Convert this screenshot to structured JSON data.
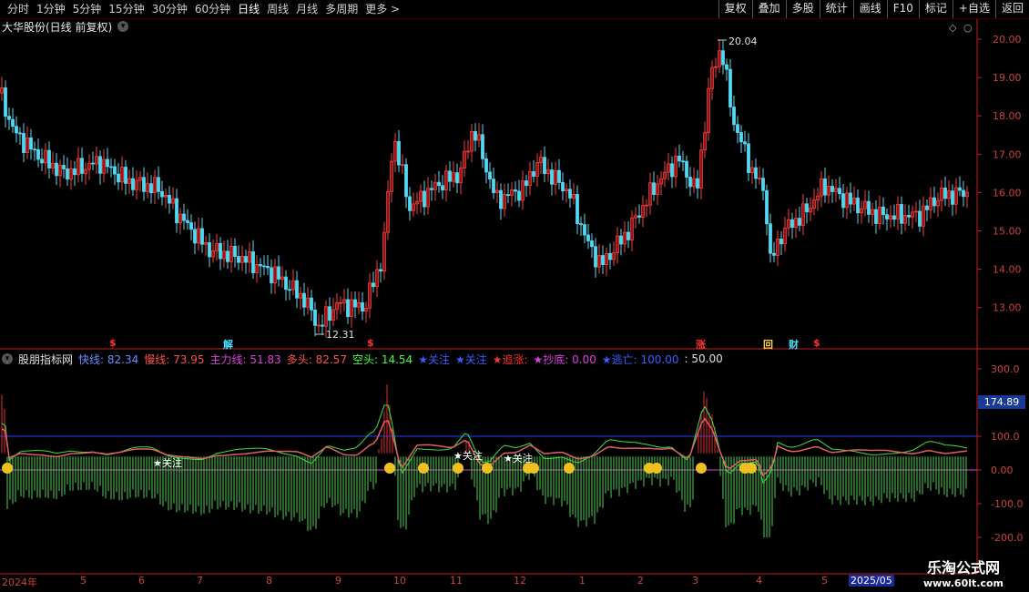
{
  "toolbar": {
    "tabs": [
      {
        "label": "分时",
        "active": false
      },
      {
        "label": "1分钟",
        "active": false
      },
      {
        "label": "5分钟",
        "active": false
      },
      {
        "label": "15分钟",
        "active": false
      },
      {
        "label": "30分钟",
        "active": false
      },
      {
        "label": "60分钟",
        "active": false
      },
      {
        "label": "日线",
        "active": true
      },
      {
        "label": "周线",
        "active": false
      },
      {
        "label": "月线",
        "active": false
      },
      {
        "label": "多周期",
        "active": false
      },
      {
        "label": "更多 >",
        "active": false
      }
    ],
    "buttons": [
      "复权",
      "叠加",
      "多股",
      "统计",
      "画线",
      "F10",
      "标记",
      "+自选",
      "返回"
    ]
  },
  "main_chart": {
    "title": "大华股份(日线 前复权)",
    "high_label": "20.04",
    "low_label": "12.31",
    "price_ticks": [
      "20.00",
      "19.00",
      "18.00",
      "17.00",
      "16.00",
      "15.00",
      "14.00",
      "13.00"
    ],
    "event_markers": [
      {
        "text": "$",
        "color": "#ff3333"
      },
      {
        "text": "解",
        "color": "#40e0ff"
      },
      {
        "text": "$",
        "color": "#ff3333"
      },
      {
        "text": "涨",
        "color": "#ff3333"
      },
      {
        "text": "回",
        "color": "#ffd040"
      },
      {
        "text": "财",
        "color": "#40e0ff"
      },
      {
        "text": "$",
        "color": "#ff3333"
      }
    ]
  },
  "indicator": {
    "name": "股朋指标网",
    "fast_label": "快线:",
    "fast_value": "82.34",
    "slow_label": "慢线:",
    "slow_value": "73.95",
    "main_label": "主力线:",
    "main_value": "51.83",
    "long_label": "多头:",
    "long_value": "82.57",
    "short_label": "空头:",
    "short_value": "14.54",
    "focus1_label": "★关注",
    "focus2_label": "★关注",
    "chase_label": "★追涨:",
    "bottom_label": "★抄底:",
    "bottom_value": "0.00",
    "escape_label": "★逃亡:",
    "escape_value": "100.00",
    "extra_value": ": 50.00",
    "current_value": "174.89",
    "ticks": [
      "300.0",
      "200.0",
      "100.0",
      "0.00",
      "-100.0",
      "-200.0"
    ],
    "annotations": [
      "★关注",
      "★关注",
      "★关注"
    ]
  },
  "date_axis": {
    "labels": [
      "2024年",
      "5",
      "6",
      "7",
      "8",
      "9",
      "10",
      "11",
      "12",
      "1",
      "2",
      "3",
      "4",
      "5",
      "2025/05"
    ]
  },
  "watermark": {
    "line1": "乐淘公式网",
    "line2": "www.60lt.com"
  },
  "colors": {
    "up": "#ff3c3c",
    "down": "#54d8f0",
    "axis": "#c02020",
    "fast": "#6a8cff",
    "slow": "#ff5050",
    "main": "#e040e0",
    "long": "#ff5050",
    "short": "#40ff40"
  }
}
